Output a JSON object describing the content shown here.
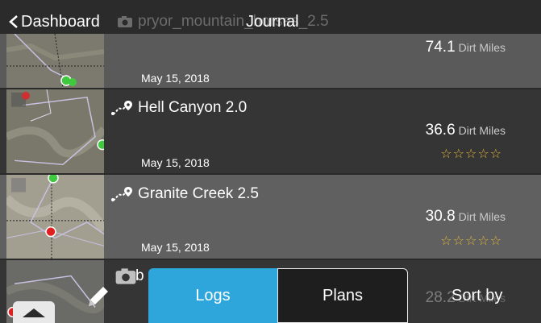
{
  "header": {
    "back_label": "Dashboard",
    "title": "Journal",
    "ghost_name": "pryor_mountain_horses_2.5"
  },
  "entries": [
    {
      "name": "",
      "date": "May 15, 2018",
      "distance": "74.1",
      "unit": "Dirt Miles",
      "stars": ""
    },
    {
      "name": "Hell Canyon 2.0",
      "date": "May 15, 2018",
      "distance": "36.6",
      "unit": "Dirt Miles",
      "stars": "☆☆☆☆☆"
    },
    {
      "name": "Granite Creek 2.5",
      "date": "May 15, 2018",
      "distance": "30.8",
      "unit": "Dirt Miles",
      "stars": "☆☆☆☆☆"
    },
    {
      "name": "b",
      "date": "",
      "distance": "28.2",
      "unit": "Dirt Miles",
      "stars": ""
    }
  ],
  "tabs": {
    "logs": "Logs",
    "plans": "Plans"
  },
  "sort_label": "Sort by",
  "colors": {
    "accent": "#2ea6dc",
    "star": "#e3b53b"
  },
  "icons": [
    "chevron-left-icon",
    "camera-icon",
    "route-icon",
    "pencil-icon",
    "expand-up-icon"
  ]
}
